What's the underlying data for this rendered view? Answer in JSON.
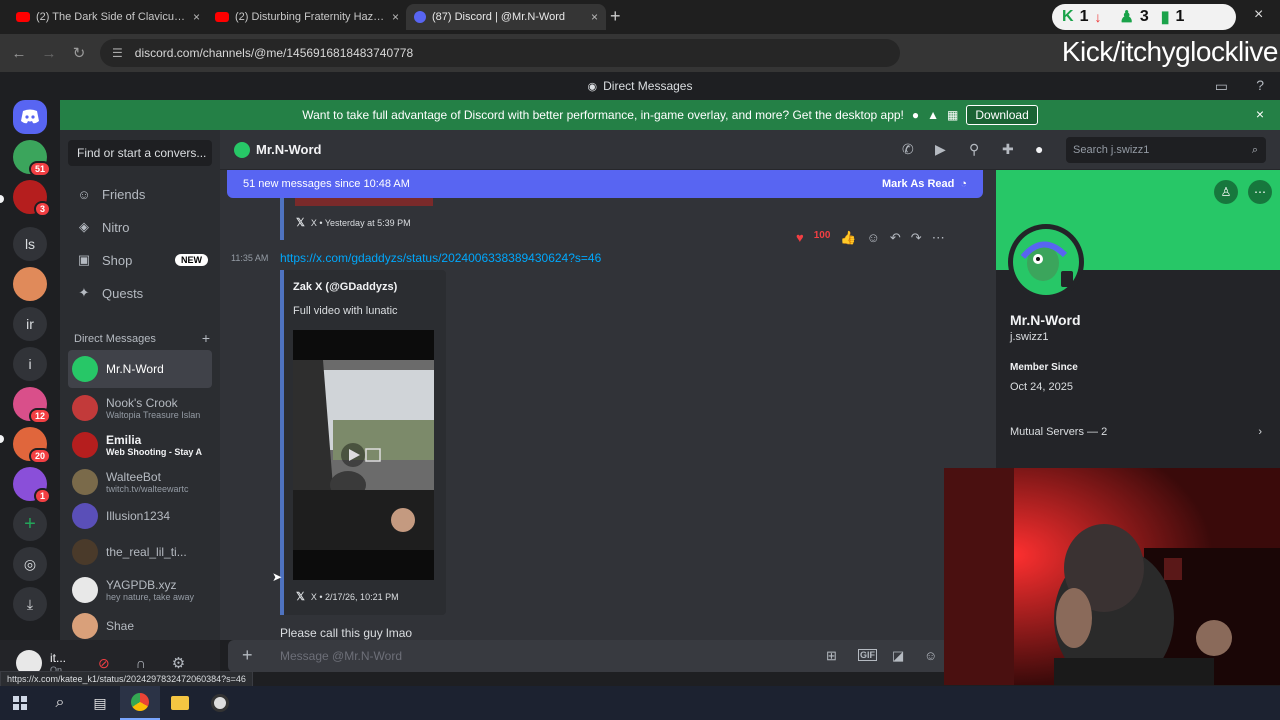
{
  "browser": {
    "tabs": [
      {
        "title": "(2) The Dark Side of Clavicular...",
        "favicon_color": "#ff0000"
      },
      {
        "title": "(2) Disturbing Fraternity Hazing...",
        "favicon_color": "#ff0000"
      },
      {
        "title": "(87) Discord | @Mr.N-Word",
        "favicon_color": "#5865f2"
      }
    ],
    "url": "discord.com/channels/@me/1456916818483740778",
    "new_tab": "+",
    "close_glyph": "×"
  },
  "overlay": {
    "kick_text": "Kick/itchyglocklive",
    "widget": {
      "down_count": "1",
      "up_count": "3",
      "signal_count": "1"
    }
  },
  "discord": {
    "title_bar": "Direct Messages",
    "banner": {
      "text": "Want to take full advantage of Discord with better performance, in-game overlay, and more? Get the desktop app!",
      "button": "Download"
    },
    "servers": [
      {
        "label": "",
        "badge": "51",
        "color": "#3ba55c"
      },
      {
        "label": "",
        "badge": "3",
        "color": "#b51e1e"
      },
      {
        "label": "ls",
        "badge": "",
        "color": "#313338"
      },
      {
        "label": "",
        "badge": "",
        "color": "#e08a5a"
      },
      {
        "label": "ir",
        "badge": "",
        "color": "#313338"
      },
      {
        "label": "i",
        "badge": "",
        "color": "#313338"
      },
      {
        "label": "",
        "badge": "12",
        "color": "#d94f8a"
      },
      {
        "label": "",
        "badge": "20",
        "color": "#e0663c"
      },
      {
        "label": "",
        "badge": "1",
        "color": "#8a4fd9"
      }
    ],
    "sidebar": {
      "search_placeholder": "Find or start a conversation",
      "search_display": "Find or start a convers...",
      "nav": [
        {
          "label": "Friends",
          "icon": "friends-icon"
        },
        {
          "label": "Nitro",
          "icon": "nitro-icon"
        },
        {
          "label": "Shop",
          "icon": "shop-icon",
          "badge": "NEW"
        },
        {
          "label": "Quests",
          "icon": "quests-icon"
        }
      ],
      "dm_header": "Direct Messages",
      "dm_add": "+",
      "dms": [
        {
          "name": "Mr.N-Word",
          "sub": "",
          "color": "#27c767"
        },
        {
          "name": "Nook's Crook",
          "sub": "Waltopia Treasure Islan",
          "color": "#c23a3a"
        },
        {
          "name": "Emilia",
          "sub": "Web Shooting - Stay A",
          "color": "#b51e1e"
        },
        {
          "name": "WalteeBot",
          "sub": "twitch.tv/walteewartc",
          "color": "#7a6a4a"
        },
        {
          "name": "Illusion1234",
          "sub": "",
          "color": "#5a4fb8"
        },
        {
          "name": "the_real_lil_ti...",
          "sub": "",
          "color": "#4a3a2a"
        },
        {
          "name": "YAGPDB.xyz",
          "sub": "hey nature, take away",
          "color": "#e8e8e8"
        },
        {
          "name": "Shae",
          "sub": "",
          "color": "#d9a07a"
        }
      ],
      "user": {
        "name": "it...",
        "status": "On..."
      }
    },
    "chat": {
      "recipient": "Mr.N-Word",
      "search_placeholder": "Search j.swizz1",
      "new_messages": "51 new messages since 10:48 AM",
      "mark_read": "Mark As Read",
      "prev_footer": "X • Yesterday at 5:39 PM",
      "message_time": "11:35 AM",
      "link": "https://x.com/gdaddyzs/status/2024006338389430624?s=46",
      "embed_author": "Zak X (@GDaddyzs)",
      "embed_desc": "Full video with lunatic",
      "embed_footer": "X • 2/17/26, 10:21 PM",
      "next_message": "Please call this guy lmao",
      "composer_placeholder": "Message @Mr.N-Word",
      "composer_add": "+"
    },
    "profile": {
      "display_name": "Mr.N-Word",
      "username": "j.swizz1",
      "member_since_label": "Member Since",
      "member_since": "Oct 24, 2025",
      "mutual_servers": "Mutual Servers — 2"
    }
  },
  "status_url": "https://x.com/katee_k1/status/2024297832472060384?s=46"
}
